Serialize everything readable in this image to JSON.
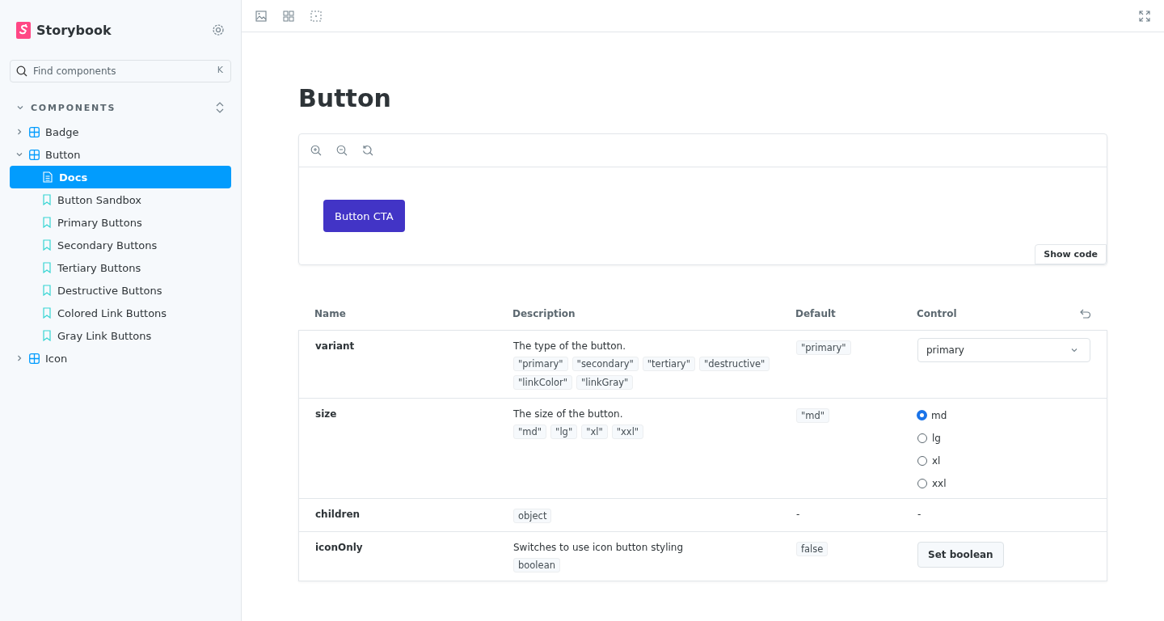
{
  "sidebar": {
    "brand": "Storybook",
    "search": {
      "placeholder": "Find components",
      "shortcut": "K"
    },
    "section": {
      "label": "COMPONENTS",
      "expanded": true
    },
    "tree": [
      {
        "label": "Badge",
        "kind": "component",
        "expanded": false,
        "selected": false
      },
      {
        "label": "Button",
        "kind": "component",
        "expanded": true,
        "selected": false,
        "children": [
          {
            "label": "Docs",
            "kind": "docs",
            "selected": true
          },
          {
            "label": "Button Sandbox",
            "kind": "story",
            "selected": false
          },
          {
            "label": "Primary Buttons",
            "kind": "story",
            "selected": false
          },
          {
            "label": "Secondary Buttons",
            "kind": "story",
            "selected": false
          },
          {
            "label": "Tertiary Buttons",
            "kind": "story",
            "selected": false
          },
          {
            "label": "Destructive Buttons",
            "kind": "story",
            "selected": false
          },
          {
            "label": "Colored Link Buttons",
            "kind": "story",
            "selected": false
          },
          {
            "label": "Gray Link Buttons",
            "kind": "story",
            "selected": false
          }
        ]
      },
      {
        "label": "Icon",
        "kind": "component",
        "expanded": false,
        "selected": false
      }
    ]
  },
  "page": {
    "title": "Button",
    "preview": {
      "button": "Button CTA",
      "show_code": "Show code"
    },
    "table": {
      "columns": [
        "Name",
        "Description",
        "Default",
        "Control"
      ],
      "rows": [
        {
          "name": "variant",
          "description": "The type of the button.",
          "types": [
            "\"primary\"",
            "\"secondary\"",
            "\"tertiary\"",
            "\"destructive\"",
            "\"linkColor\"",
            "\"linkGray\""
          ],
          "default": "\"primary\"",
          "default_tag": true,
          "control": {
            "kind": "select",
            "value": "primary"
          }
        },
        {
          "name": "size",
          "description": "The size of the button.",
          "types": [
            "\"md\"",
            "\"lg\"",
            "\"xl\"",
            "\"xxl\""
          ],
          "default": "\"md\"",
          "default_tag": true,
          "control": {
            "kind": "radio",
            "options": [
              {
                "label": "md",
                "selected": true
              },
              {
                "label": "lg",
                "selected": false
              },
              {
                "label": "xl",
                "selected": false
              },
              {
                "label": "xxl",
                "selected": false
              }
            ]
          }
        },
        {
          "name": "children",
          "types": [
            "object"
          ],
          "default": "-",
          "default_tag": false,
          "control": {
            "kind": "text",
            "value": "-"
          }
        },
        {
          "name": "iconOnly",
          "description": "Switches to use icon button styling",
          "types": [
            "boolean"
          ],
          "default": "false",
          "default_tag": true,
          "control": {
            "kind": "button",
            "label": "Set boolean"
          }
        }
      ]
    }
  }
}
